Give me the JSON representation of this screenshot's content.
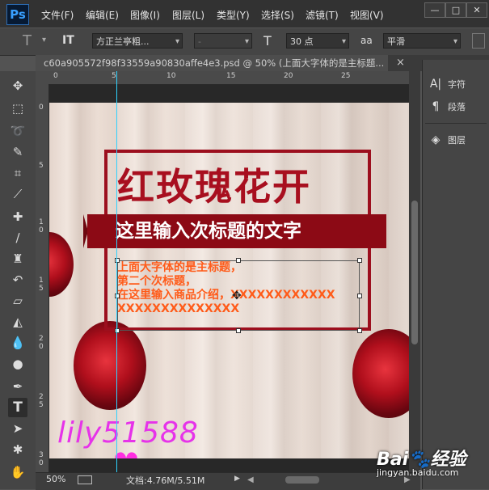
{
  "app": {
    "logo": "Ps",
    "menu": [
      "文件(F)",
      "编辑(E)",
      "图像(I)",
      "图层(L)",
      "类型(Y)",
      "选择(S)",
      "滤镜(T)",
      "视图(V)"
    ],
    "window_controls": [
      "—",
      "□",
      "✕"
    ]
  },
  "options": {
    "tool_glyph": "T",
    "orient_glyph": "IT",
    "font_family": "方正兰亭粗...",
    "font_style": "-",
    "size_glyph": "T",
    "font_size": "30 点",
    "aa_glyph": "aa",
    "antialias": "平滑"
  },
  "document": {
    "tab_title": "c60a905572f98f33559a90830affe4e3.psd @ 50% (上面大字体的是主标题...",
    "tab_close": "×"
  },
  "rulers": {
    "h_ticks": [
      "0",
      "5",
      "10",
      "15",
      "20",
      "25"
    ],
    "v_ticks": [
      "0",
      "5",
      "1 0",
      "1 5",
      "2 0",
      "2 5",
      "3 0"
    ]
  },
  "artwork": {
    "main_title": "红玫瑰花开",
    "subtitle": "这里输入次标题的文字",
    "body_lines": [
      "上面大字体的是主标题，",
      "第二个次标题，",
      "在这里输入商品介绍，XXXXXXXXXXXX",
      "XXXXXXXXXXXXXX"
    ],
    "watermark": "lily51588",
    "heart": "♥"
  },
  "status": {
    "zoom": "50%",
    "doc_info": "文档:4.76M/5.51M",
    "arrow": "▶"
  },
  "panels": {
    "items": [
      {
        "label": "字符",
        "icon": "A|"
      },
      {
        "label": "段落",
        "icon": "¶"
      },
      {
        "label": "图层",
        "icon": "◈"
      }
    ]
  },
  "site_watermark": {
    "line1_a": "Bai",
    "line1_b": "经验",
    "line2": "jingyan.baidu.com"
  },
  "colors": {
    "canvas_red": "#9c0f1e",
    "body_orange": "#ff5b19",
    "guide": "#2fd3ff",
    "watermark_pink": "#e633e9"
  }
}
